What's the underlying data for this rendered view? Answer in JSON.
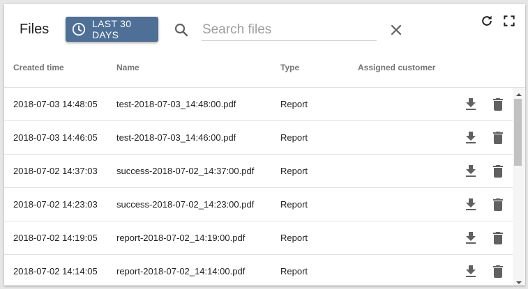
{
  "header": {
    "title": "Files",
    "time_button_label": "LAST 30 DAYS",
    "search_placeholder": "Search files"
  },
  "table": {
    "columns": [
      "Created time",
      "Name",
      "Type",
      "Assigned customer"
    ],
    "rows": [
      {
        "created": "2018-07-03 14:48:05",
        "name": "test-2018-07-03_14:48:00.pdf",
        "type": "Report",
        "customer": ""
      },
      {
        "created": "2018-07-03 14:46:05",
        "name": "test-2018-07-03_14:46:00.pdf",
        "type": "Report",
        "customer": ""
      },
      {
        "created": "2018-07-02 14:37:03",
        "name": "success-2018-07-02_14:37:00.pdf",
        "type": "Report",
        "customer": ""
      },
      {
        "created": "2018-07-02 14:23:03",
        "name": "success-2018-07-02_14:23:00.pdf",
        "type": "Report",
        "customer": ""
      },
      {
        "created": "2018-07-02 14:19:05",
        "name": "report-2018-07-02_14:19:00.pdf",
        "type": "Report",
        "customer": ""
      },
      {
        "created": "2018-07-02 14:14:05",
        "name": "report-2018-07-02_14:14:00.pdf",
        "type": "Report",
        "customer": ""
      }
    ]
  },
  "icons": {
    "time": "clock-icon",
    "search": "search-icon",
    "clear": "close-icon",
    "refresh": "refresh-icon",
    "fullscreen": "fullscreen-icon",
    "download": "download-icon",
    "delete": "trash-icon"
  },
  "colors": {
    "accent": "#4e6f96",
    "icon": "#616161",
    "divider": "#e0e0e0"
  }
}
